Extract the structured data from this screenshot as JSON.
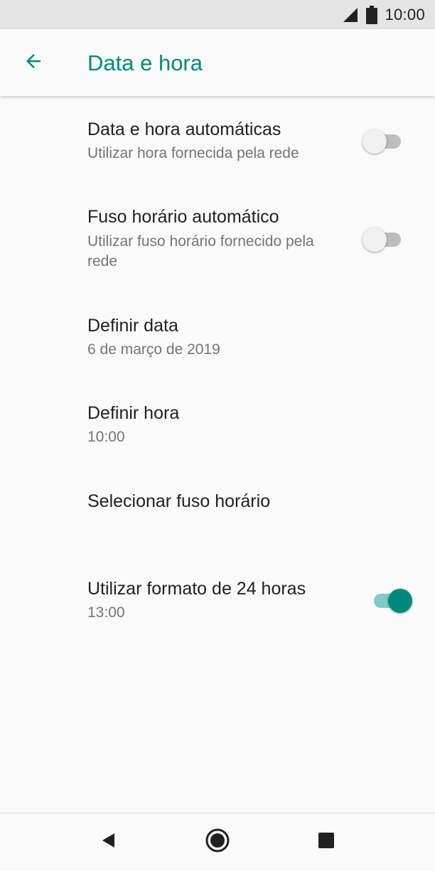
{
  "status_bar": {
    "time": "10:00",
    "icons": [
      "signal-icon",
      "battery-icon"
    ]
  },
  "app_bar": {
    "back_icon": "arrow-left-icon",
    "title": "Data e hora"
  },
  "settings": [
    {
      "title": "Data e hora automáticas",
      "subtitle": "Utilizar hora fornecida pela rede",
      "toggle": "off"
    },
    {
      "title": "Fuso horário automático",
      "subtitle": "Utilizar fuso horário fornecido pela rede",
      "toggle": "off"
    },
    {
      "title": "Definir data",
      "subtitle": "6 de março de 2019"
    },
    {
      "title": "Definir hora",
      "subtitle": "10:00"
    },
    {
      "title": "Selecionar fuso horário"
    },
    {
      "title": "Utilizar formato de 24 horas",
      "subtitle": "13:00",
      "toggle": "on"
    }
  ],
  "nav_bar": {
    "icons": [
      "back-triangle-icon",
      "home-circle-icon",
      "recents-square-icon"
    ]
  },
  "colors": {
    "accent": "#00897b",
    "accent_light": "#80cbc4",
    "status_bar_bg": "#e4e4e4",
    "background": "#fafafa"
  }
}
